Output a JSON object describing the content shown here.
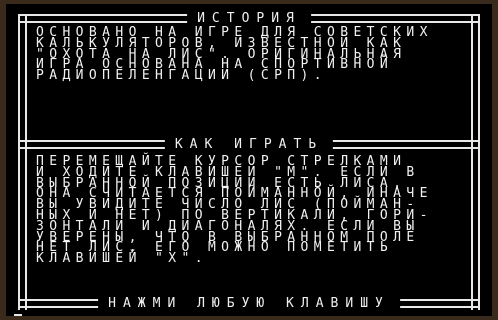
{
  "sections": {
    "history": {
      "title": "ИСТОРИЯ",
      "lines": [
        "ОСНОВАНО НА ИГРЕ ДЛЯ СОВЕТСКИХ",
        "КАЛЬКУЛЯТОРОВ, ИЗВЕСТНОЙ КАК",
        "\"ОХОТА НА ЛИС\". ОРИГИНАЛЬНАЯ",
        "ИГРА ОСНОВАНА НА СПОРТИВНОЙ",
        "РАДИОПЕЛЕНГАЦИИ (СРП)."
      ]
    },
    "howto": {
      "title": "КАК ИГРАТЬ",
      "lines": [
        "ПЕРЕМЕЩАЙТЕ КУРСОР СТРЕЛКАМИ",
        "И ХОДИТЕ КЛАВИШЕЙ \"М\". ЕСЛИ В",
        "ВЫБРАННОЙ ПОЗИЦИИ ЕСТЬ ЛИСА,",
        "ОНА СЧИТАЕТСЯ ПОЙМАННОЙ, ИНАЧЕ",
        "ВЫ УВИДИТЕ ЧИСЛО ЛИС (ПОЙМАН-",
        "НЫХ И НЕТ) ПО ВЕРТИКАЛИ, ГОРИ-",
        "ЗОНТАЛИ И ДИАГОНАЛЯХ. ЕСЛИ ВЫ",
        "УВЕРЕНЫ, ЧТО В ВЫБРАННОМ ПОЛЕ",
        "НЕТ ЛИС, ЕГО МОЖНО ПОМЕТИТЬ",
        "КЛАВИШЕЙ \"Х\"."
      ]
    }
  },
  "prompt": "НАЖМИ ЛЮБУЮ КЛАВИШУ"
}
